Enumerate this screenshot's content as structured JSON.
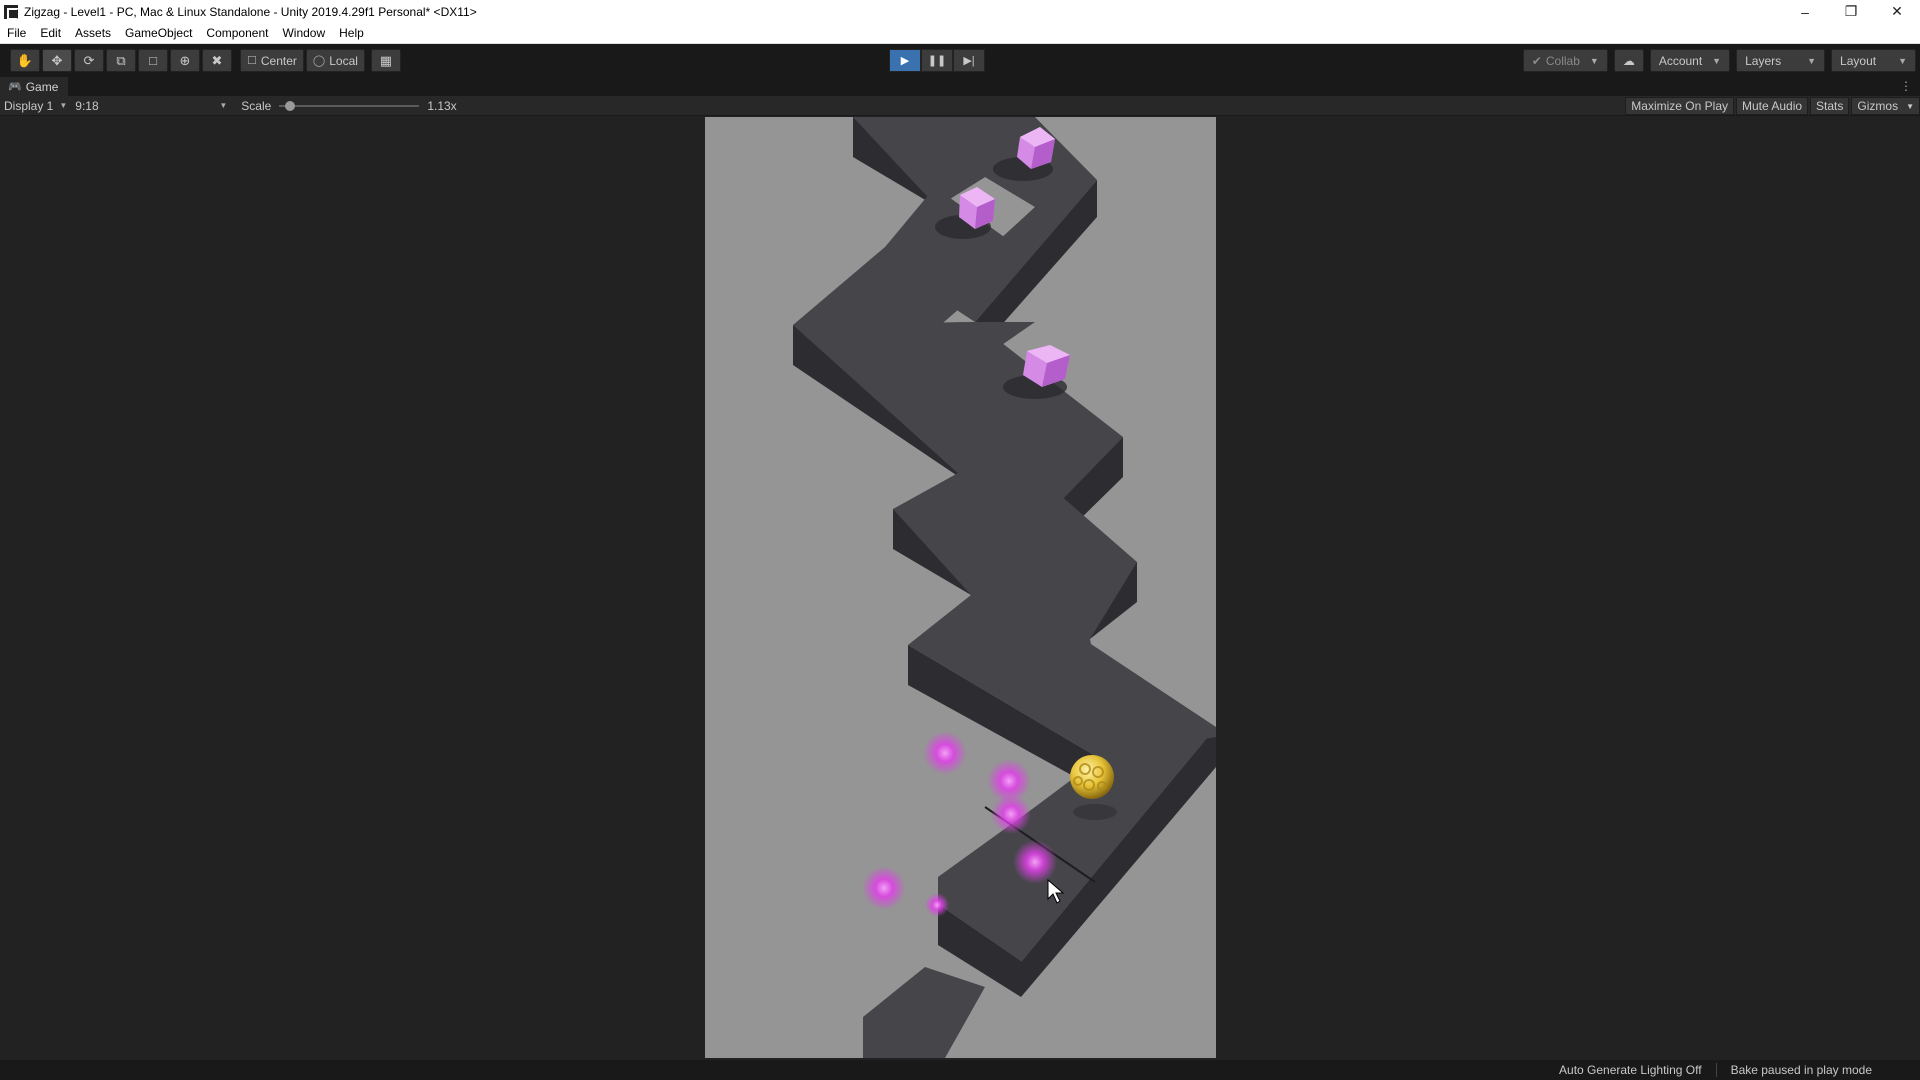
{
  "window": {
    "title": "Zigzag - Level1 - PC, Mac & Linux Standalone - Unity 2019.4.29f1 Personal* <DX11>"
  },
  "menu": [
    "File",
    "Edit",
    "Assets",
    "GameObject",
    "Component",
    "Window",
    "Help"
  ],
  "toolbar": {
    "tools": [
      {
        "name": "hand-tool",
        "icon": "hand-icon"
      },
      {
        "name": "move-tool",
        "icon": "move-icon",
        "active": true
      },
      {
        "name": "rotate-tool",
        "icon": "rotate-icon"
      },
      {
        "name": "scale-tool",
        "icon": "scale-icon"
      },
      {
        "name": "rect-tool",
        "icon": "rect-icon"
      },
      {
        "name": "transform-tool",
        "icon": "transform-icon"
      },
      {
        "name": "custom-tool",
        "icon": "tools-icon"
      }
    ],
    "pivot_label": "Center",
    "rotation_label": "Local",
    "collab_label": "Collab",
    "account_label": "Account",
    "layers_label": "Layers",
    "layout_label": "Layout"
  },
  "game_tab": {
    "label": "Game",
    "display_label": "Display 1",
    "aspect_label": "9:18",
    "scale_label": "Scale",
    "scale_value_label": "1.13x",
    "scale_value": 1.13,
    "maximize_label": "Maximize On Play",
    "mute_label": "Mute Audio",
    "stats_label": "Stats",
    "gizmos_label": "Gizmos"
  },
  "status": {
    "lighting_label": "Auto Generate Lighting Off",
    "bake_label": "Bake paused in play mode"
  },
  "colors": {
    "play_active": "#3a72b0",
    "game_background": "#959595",
    "path_top": "#454549",
    "path_side": "#2e2e32",
    "crystal": "#d07ae0",
    "particle": "#e040e8",
    "ball": "#e8c840"
  }
}
